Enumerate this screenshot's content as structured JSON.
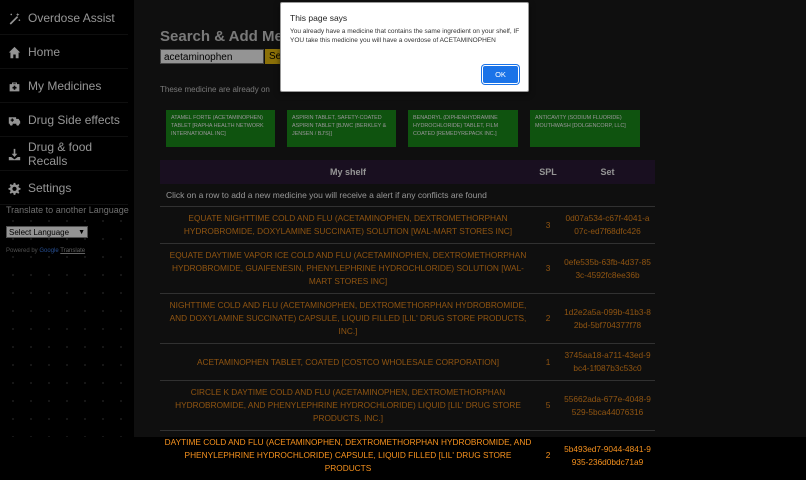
{
  "sidebar": {
    "brand": "Overdose Assist",
    "items": [
      {
        "label": "Home"
      },
      {
        "label": "My Medicines"
      },
      {
        "label": "Drug Side effects"
      },
      {
        "label": "Drug & food Recalls"
      },
      {
        "label": "Settings"
      }
    ],
    "translate_label": "Translate to another Language",
    "language_select": "Select Language",
    "powered_by": "Powered by",
    "google": "Google",
    "translate": "Translate"
  },
  "main": {
    "title": "Search & Add Medic",
    "search_value": "acetaminophen",
    "search_button": "Se",
    "info_text": "These medicine are already on",
    "info_tail": "e"
  },
  "chips": [
    "ATAMEL FORTE (ACETAMINOPHEN) TABLET [RAPHA HEALTH NETWORK INTERNATIONAL INC]",
    "ASPIRIN TABLET, SAFETY-COATED ASPIRIN TABLET [BJWC (BERKLEY & JENSEN / BJ'S)]",
    "BENADRYL (DIPHENHYDRAMINE HYDROCHLORIDE) TABLET, FILM COATED [REMEDYREPACK INC.]",
    "ANTICAVITY (SODIUM FLUORIDE) MOUTHWASH [DOLGENCORP, LLC]"
  ],
  "table": {
    "headers": [
      "My shelf",
      "SPL",
      "Set"
    ],
    "note": "Click on a row to add a new medicine you will receive a alert if any conflicts are found",
    "rows": [
      {
        "name": "EQUATE NIGHTTIME COLD AND FLU (ACETAMINOPHEN, DEXTROMETHORPHAN HYDROBROMIDE, DOXYLAMINE SUCCINATE) SOLUTION [WAL-MART STORES INC]",
        "spl": "3",
        "set": "0d07a534-c67f-4041-a07c-ed7f68dfc426"
      },
      {
        "name": "EQUATE DAYTIME VAPOR ICE COLD AND FLU (ACETAMINOPHEN, DEXTROMETHORPHAN HYDROBROMIDE, GUAIFENESIN, PHENYLEPHRINE HYDROCHLORIDE) SOLUTION [WAL-MART STORES INC]",
        "spl": "3",
        "set": "0efe535b-63fb-4d37-853c-4592fc8ee36b"
      },
      {
        "name": "NIGHTTIME COLD AND FLU (ACETAMINOPHEN, DEXTROMETHORPHAN HYDROBROMIDE, AND DOXYLAMINE SUCCINATE) CAPSULE, LIQUID FILLED [LIL' DRUG STORE PRODUCTS, INC.]",
        "spl": "2",
        "set": "1d2e2a5a-099b-41b3-82bd-5bf704377f78"
      },
      {
        "name": "ACETAMINOPHEN TABLET, COATED [COSTCO WHOLESALE CORPORATION]",
        "spl": "1",
        "set": "3745aa18-a711-43ed-9bc4-1f087b3c53c0"
      },
      {
        "name": "CIRCLE K DAYTIME COLD AND FLU (ACETAMINOPHEN, DEXTROMETHORPHAN HYDROBROMIDE, AND PHENYLEPHRINE HYDROCHLORIDE) LIQUID [LIL' DRUG STORE PRODUCTS, INC.]",
        "spl": "5",
        "set": "55662ada-677e-4048-9529-5bca44076316"
      },
      {
        "name": "DAYTIME COLD AND FLU (ACETAMINOPHEN, DEXTROMETHORPHAN HYDROBROMIDE, AND PHENYLEPHRINE HYDROCHLORIDE) CAPSULE, LIQUID FILLED [LIL' DRUG STORE PRODUCTS",
        "spl": "2",
        "set": "5b493ed7-9044-4841-9935-236d0bdc71a9"
      }
    ]
  },
  "dialog": {
    "title": "This page says",
    "message": "You already have a medicine that contains the same ingredient on your shelf, IF YOU take this medicine you will have a overdose of ACETAMINOPHEN",
    "ok": "OK",
    "accent": "#1a73e8"
  }
}
